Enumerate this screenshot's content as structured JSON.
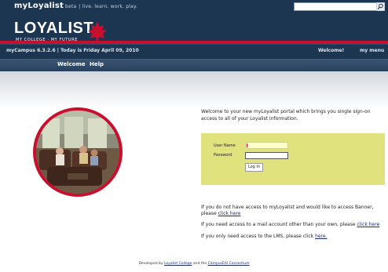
{
  "topbar": {
    "brand": "myLoyalist",
    "beta": "beta",
    "tagline": "| live. learn. work. play.",
    "search": {
      "value": "",
      "placeholder": ""
    }
  },
  "banner": {
    "logo_text": "LOYALIST",
    "logo_sub": "MY COLLEGE · MY FUTURE"
  },
  "status": {
    "text": "myCampus 6.3.2.6 | Today is Friday April 09, 2010",
    "welcome": "Welcome!",
    "my_menu": "my menu"
  },
  "nav": {
    "tabs": [
      {
        "label": "Welcome"
      },
      {
        "label": "Help"
      }
    ]
  },
  "intro": "Welcome to your new myLoyalist portal which brings you single sign-on access to all of your Loyalist Information.",
  "login": {
    "username_label": "User Name",
    "password_label": "Password",
    "username_value": "",
    "password_value": "",
    "button": "Log In"
  },
  "links": {
    "p1_text": "If you do not have access to myLoyalist and would like to access Banner, please ",
    "p1_link": "click here",
    "p2_text": "If you need access to a mail account other than your own, please ",
    "p2_link": "click here",
    "p3_text": "If you only need access to the LMS, please click ",
    "p3_link": "here."
  },
  "footer": {
    "prefix": "Developed by ",
    "link1": "Loyalist College",
    "mid": " and the ",
    "link2": "CampusEAI Consortium"
  },
  "colors": {
    "navy": "#1c3550",
    "red": "#c8102e",
    "login_bg": "#dfe27d",
    "link": "#1a2c78"
  }
}
